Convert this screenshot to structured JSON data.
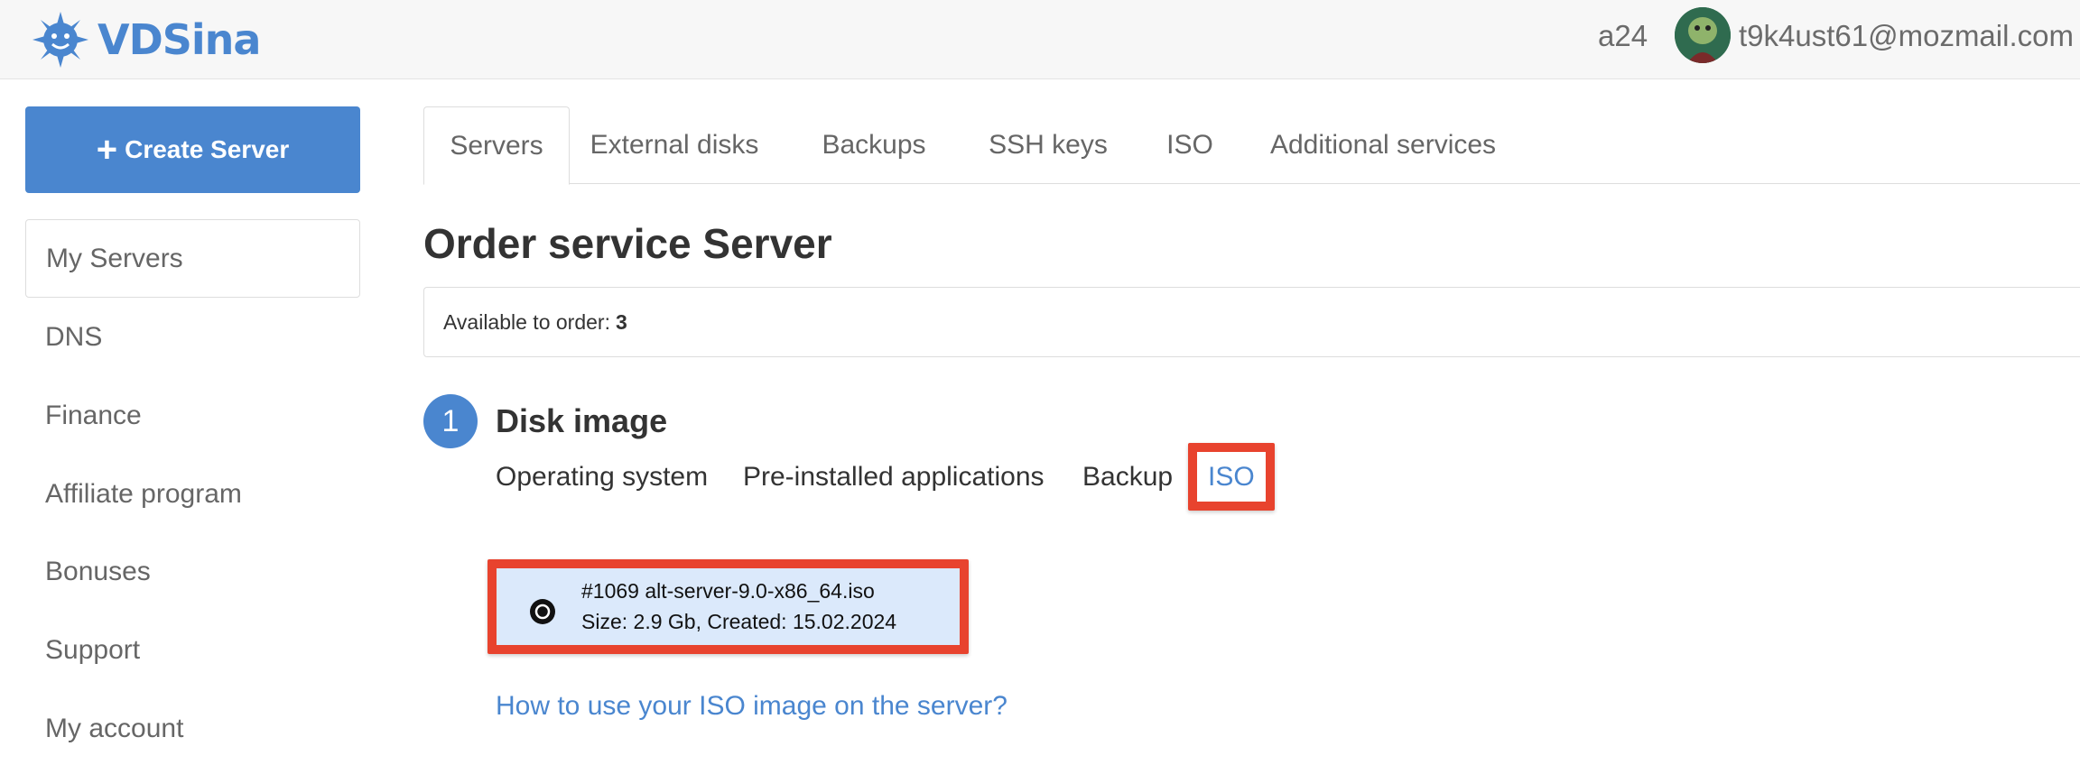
{
  "header": {
    "logo_text": "VDSina",
    "user_short": "a24",
    "email": "t9k4ust61@mozmail.com"
  },
  "sidebar": {
    "create_button": "Create Server",
    "items": [
      {
        "label": "My Servers",
        "active": true
      },
      {
        "label": "DNS"
      },
      {
        "label": "Finance"
      },
      {
        "label": "Affiliate program"
      },
      {
        "label": "Bonuses"
      },
      {
        "label": "Support"
      },
      {
        "label": "My account"
      }
    ]
  },
  "tabs": [
    {
      "label": "Servers",
      "active": true
    },
    {
      "label": "External disks"
    },
    {
      "label": "Backups"
    },
    {
      "label": "SSH keys"
    },
    {
      "label": "ISO"
    },
    {
      "label": "Additional services"
    }
  ],
  "page_title": "Order service Server",
  "availability": {
    "label": "Available to order:",
    "count": "3"
  },
  "step": {
    "number": "1",
    "title": "Disk image",
    "image_tabs": [
      {
        "label": "Operating system"
      },
      {
        "label": "Pre-installed applications"
      },
      {
        "label": "Backup"
      },
      {
        "label": "ISO",
        "active": true
      }
    ]
  },
  "iso_item": {
    "name": "#1069 alt-server-9.0-x86_64.iso",
    "meta": "Size: 2.9 Gb, Created: 15.02.2024"
  },
  "help_link": "How to use your ISO image on the server?",
  "colors": {
    "accent": "#4a86cf",
    "highlight": "#e8432e",
    "selected_bg": "#dbe9fb"
  }
}
